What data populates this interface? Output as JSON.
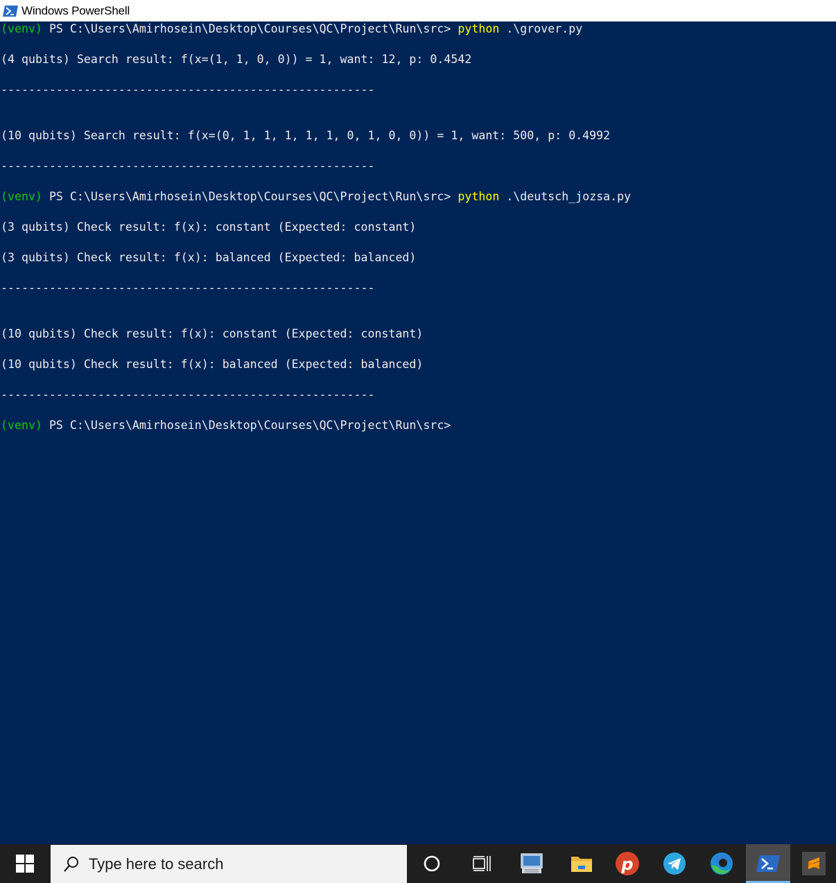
{
  "window": {
    "title": "Windows PowerShell"
  },
  "console": {
    "lines": [
      {
        "segments": [
          {
            "text": "(venv)",
            "color": "green"
          },
          {
            "text": " PS C:\\Users\\Amirhosein\\Desktop\\Courses\\QC\\Project\\Run\\src> ",
            "color": "white"
          },
          {
            "text": "python",
            "color": "yellow"
          },
          {
            "text": " .\\grover.py",
            "color": "white"
          }
        ]
      },
      {
        "segments": []
      },
      {
        "segments": [
          {
            "text": "(4 qubits) Search result: f(x=(1, 1, 0, 0)) = 1, want: 12, p: 0.4542",
            "color": "white"
          }
        ]
      },
      {
        "segments": []
      },
      {
        "segments": [
          {
            "text": "------------------------------------------------------",
            "color": "white"
          }
        ]
      },
      {
        "segments": []
      },
      {
        "segments": []
      },
      {
        "segments": [
          {
            "text": "(10 qubits) Search result: f(x=(0, 1, 1, 1, 1, 1, 0, 1, 0, 0)) = 1, want: 500, p: 0.4992",
            "color": "white"
          }
        ]
      },
      {
        "segments": []
      },
      {
        "segments": [
          {
            "text": "------------------------------------------------------",
            "color": "white"
          }
        ]
      },
      {
        "segments": []
      },
      {
        "segments": [
          {
            "text": "(venv)",
            "color": "green"
          },
          {
            "text": " PS C:\\Users\\Amirhosein\\Desktop\\Courses\\QC\\Project\\Run\\src> ",
            "color": "white"
          },
          {
            "text": "python",
            "color": "yellow"
          },
          {
            "text": " .\\deutsch_jozsa.py",
            "color": "white"
          }
        ]
      },
      {
        "segments": []
      },
      {
        "segments": [
          {
            "text": "(3 qubits) Check result: f(x): constant (Expected: constant)",
            "color": "white"
          }
        ]
      },
      {
        "segments": []
      },
      {
        "segments": [
          {
            "text": "(3 qubits) Check result: f(x): balanced (Expected: balanced)",
            "color": "white"
          }
        ]
      },
      {
        "segments": []
      },
      {
        "segments": [
          {
            "text": "------------------------------------------------------",
            "color": "white"
          }
        ]
      },
      {
        "segments": []
      },
      {
        "segments": []
      },
      {
        "segments": [
          {
            "text": "(10 qubits) Check result: f(x): constant (Expected: constant)",
            "color": "white"
          }
        ]
      },
      {
        "segments": []
      },
      {
        "segments": [
          {
            "text": "(10 qubits) Check result: f(x): balanced (Expected: balanced)",
            "color": "white"
          }
        ]
      },
      {
        "segments": []
      },
      {
        "segments": [
          {
            "text": "------------------------------------------------------",
            "color": "white"
          }
        ]
      },
      {
        "segments": []
      },
      {
        "segments": [
          {
            "text": "(venv)",
            "color": "green"
          },
          {
            "text": " PS C:\\Users\\Amirhosein\\Desktop\\Courses\\QC\\Project\\Run\\src>",
            "color": "white"
          }
        ]
      }
    ]
  },
  "colors": {
    "console_bg": "#012456",
    "green": "#13c913",
    "yellow": "#ffff00",
    "white": "#eeedf0",
    "taskbar_bg": "#1f1f1f"
  },
  "taskbar": {
    "search_placeholder": "Type here to search",
    "apps": [
      {
        "name": "cortana-icon"
      },
      {
        "name": "task-view-icon"
      },
      {
        "name": "remote-desktop-icon"
      },
      {
        "name": "file-explorer-icon"
      },
      {
        "name": "psiphon-icon"
      },
      {
        "name": "telegram-icon"
      },
      {
        "name": "edge-icon"
      },
      {
        "name": "powershell-icon"
      },
      {
        "name": "sublime-text-icon"
      }
    ]
  }
}
